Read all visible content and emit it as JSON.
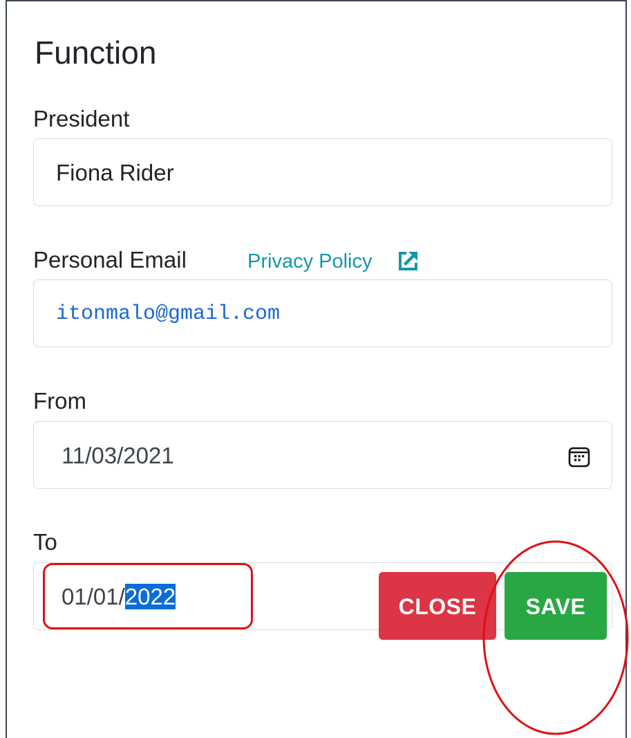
{
  "dialog": {
    "title": "Function"
  },
  "president": {
    "label": "President",
    "value": "Fiona Rider"
  },
  "email": {
    "label": "Personal Email",
    "privacy_link": "Privacy Policy",
    "value": "itonmalo@gmail.com"
  },
  "from": {
    "label": "From",
    "value": "11/03/2021"
  },
  "to": {
    "label": "To",
    "value_prefix": "01/01/",
    "value_selected": "2022"
  },
  "buttons": {
    "close": "CLOSE",
    "save": "SAVE"
  },
  "icons": {
    "calendar": "calendar-icon",
    "external": "external-link-icon"
  },
  "colors": {
    "close": "#dc3545",
    "save": "#28a745",
    "link": "#1497a8",
    "email_text": "#1a66d9",
    "selection": "#0a6dd8",
    "annotation": "#e01010"
  }
}
